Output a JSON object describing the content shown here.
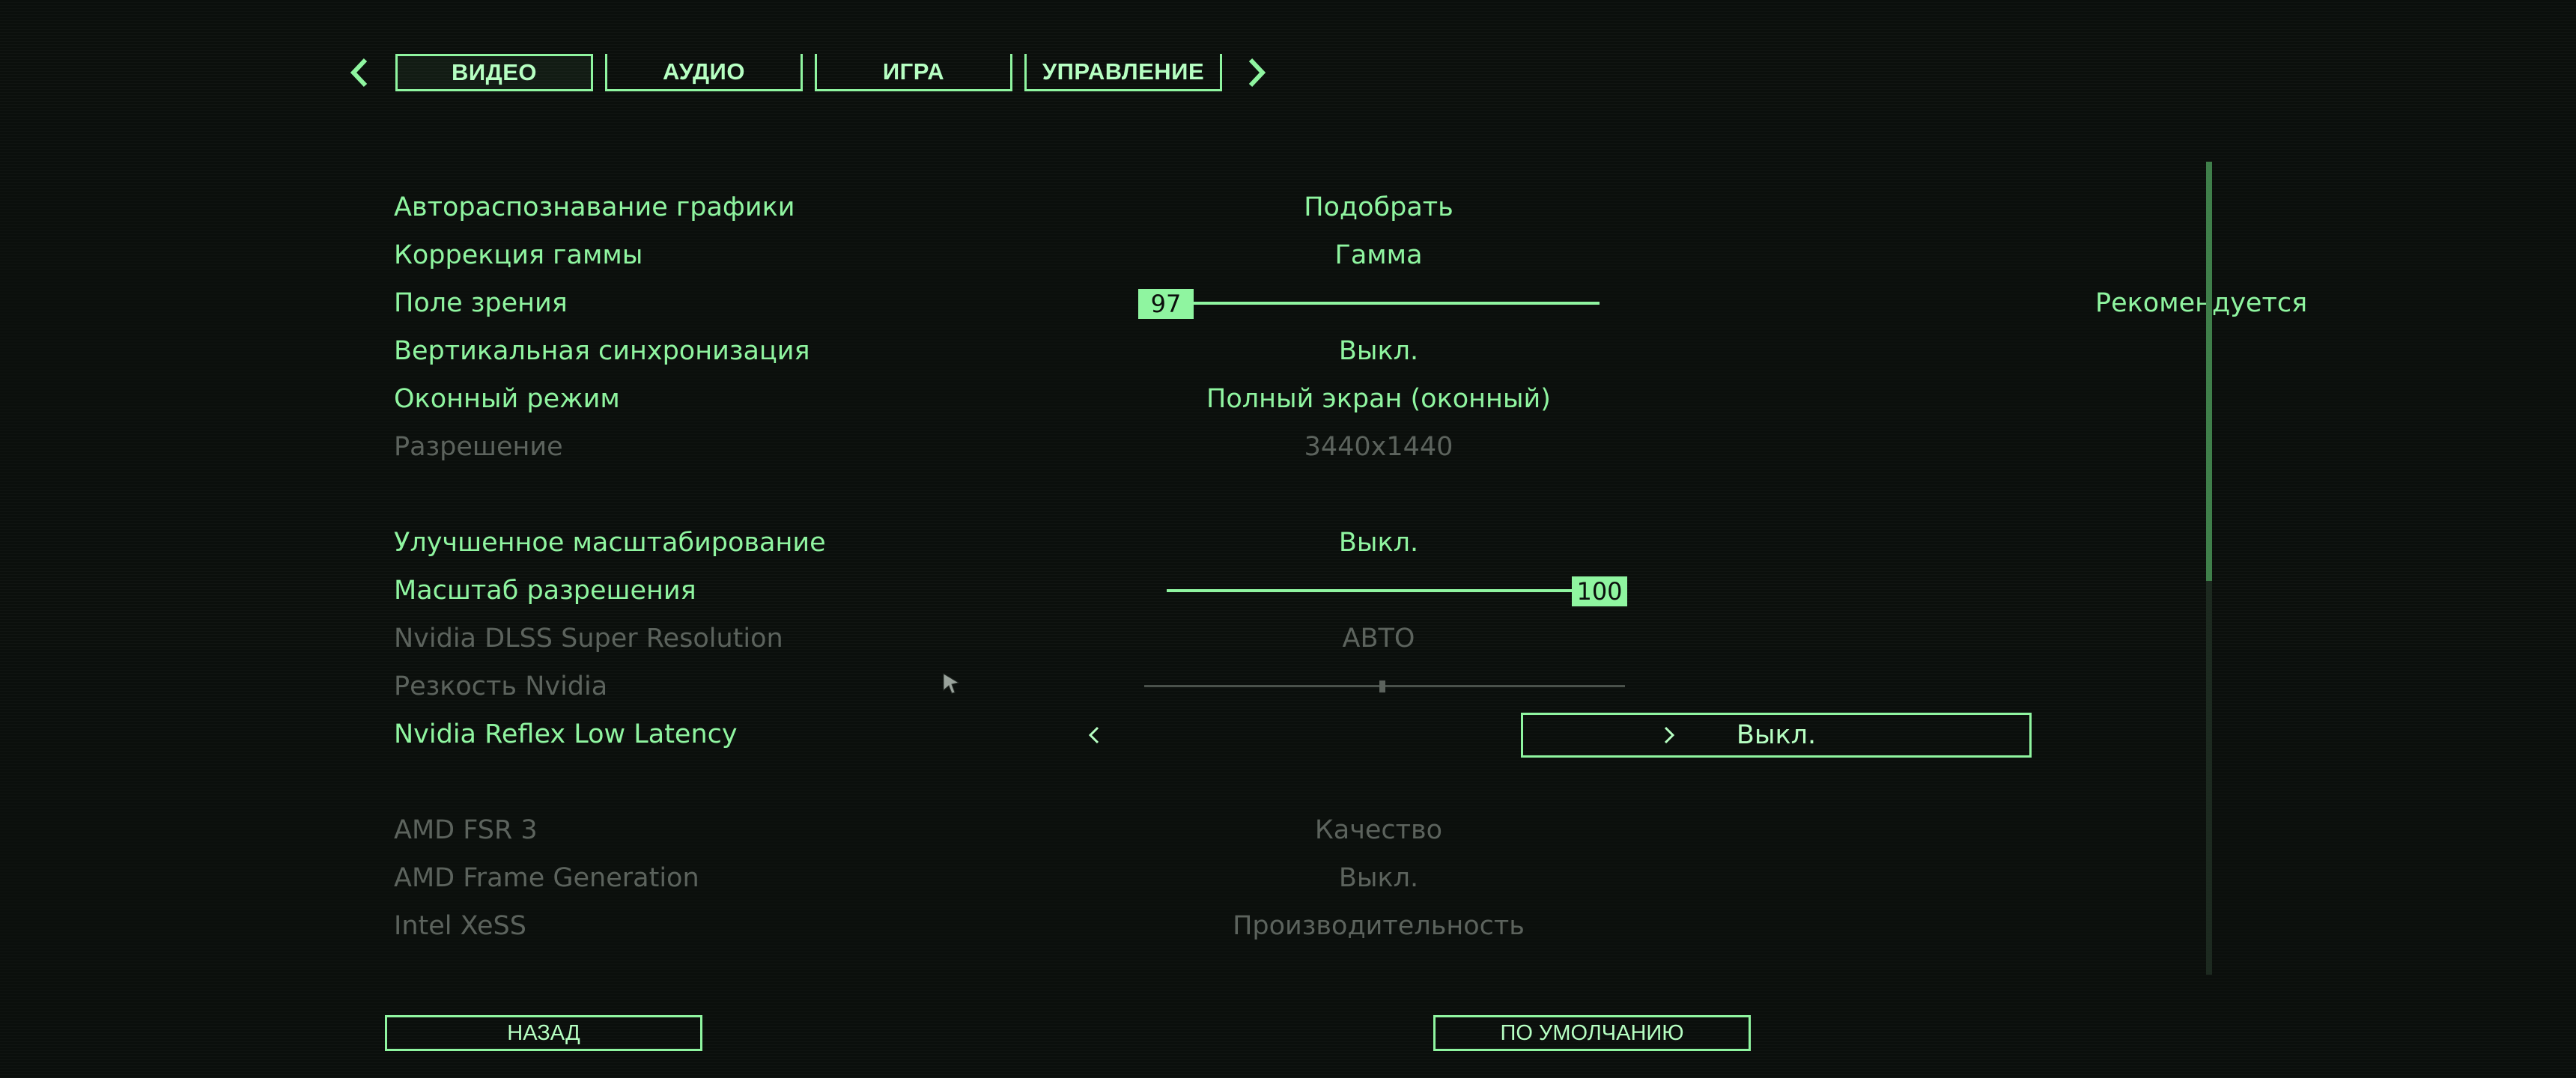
{
  "tabs": [
    {
      "label": "ВИДЕО",
      "active": true
    },
    {
      "label": "АУДИО",
      "active": false
    },
    {
      "label": "ИГРА",
      "active": false
    },
    {
      "label": "УПРАВЛЕНИЕ",
      "active": false
    }
  ],
  "settings": [
    {
      "label": "Авторас­познавание графики",
      "value": "Подобрать"
    },
    {
      "label": "Коррекция гаммы",
      "value": "Гамма"
    },
    {
      "label": "Поле зрения",
      "slider_value": "97",
      "slider_fraction": 0.0,
      "note": "Рекомендуется"
    },
    {
      "label": "Вертикальная синхронизация",
      "value": "Выкл."
    },
    {
      "label": "Оконный режим",
      "value": "Полный экран (оконный)"
    },
    {
      "label": "Разрешение",
      "value": "3440x1440"
    },
    {
      "label": "Улучшенное масштабирование",
      "value": "Выкл."
    },
    {
      "label": "Масштаб разрешения",
      "slider_value": "100",
      "slider_fraction": 1.0
    },
    {
      "label": "Nvidia DLSS Super Resolution",
      "value": "АВТО"
    },
    {
      "label": "Резкость Nvidia",
      "slider_fraction": 0.5
    },
    {
      "label": "Nvidia Reflex Low Latency",
      "value": "Выкл."
    },
    {
      "label": "AMD FSR 3",
      "value": "Качество"
    },
    {
      "label": "AMD Frame Generation",
      "value": "Выкл."
    },
    {
      "label": "Intel XeSS",
      "value": "Производительность"
    }
  ],
  "footer": {
    "back_label": "НАЗАД",
    "default_label": "ПО УМОЛЧАНИЮ"
  },
  "icons": {
    "tab_prev": "chevron-left-icon",
    "tab_next": "chevron-right-icon",
    "option_prev": "chevron-left-icon",
    "option_next": "chevron-right-icon",
    "cursor": "mouse-cursor-icon"
  },
  "colors": {
    "accent": "#8ff5a0",
    "highlight_text": "#b6ffc2",
    "disabled": "#5c635d",
    "background": "#0b0f0c"
  }
}
